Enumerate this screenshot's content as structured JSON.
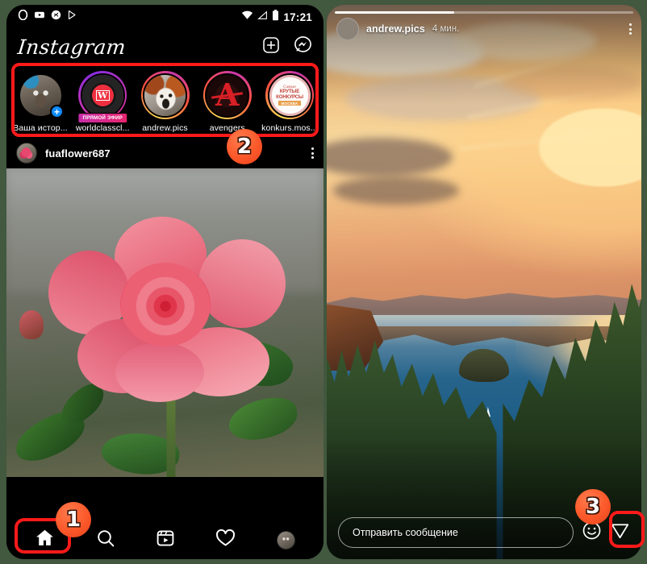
{
  "left_phone": {
    "statusbar": {
      "app_icons": [
        "opera-icon",
        "youtube-icon",
        "shazam-icon",
        "play-store-icon"
      ],
      "wifi_icon": "wifi-icon",
      "signal_icon": "signal-icon",
      "battery_icon": "battery-icon",
      "time": "17:21"
    },
    "header": {
      "logo_text": "Instagram",
      "new_post_label": "+",
      "messenger_icon": "messenger-icon"
    },
    "stories": [
      {
        "name": "Ваша истор...",
        "ring": "none",
        "avatar": "wolf-avatar",
        "has_plus": true,
        "live": null
      },
      {
        "name": "worldclasscl...",
        "ring": "live",
        "avatar": "w-logo-avatar",
        "has_plus": false,
        "live": "ПРЯМОЙ ЭФИР"
      },
      {
        "name": "andrew.pics",
        "ring": "grad",
        "avatar": "red-panda-avatar",
        "has_plus": false,
        "live": null
      },
      {
        "name": "avengers",
        "ring": "grad",
        "avatar": "avengers-avatar",
        "has_plus": false,
        "live": null
      },
      {
        "name": "konkurs.mos...",
        "ring": "orange",
        "avatar": "konkurs-avatar",
        "has_plus": false,
        "live": null
      }
    ],
    "konkurs_avatar_text": {
      "line1": "Самые",
      "line2": "КРУТЫЕ",
      "line3": "КОНКУРСЫ",
      "line4": "МОСКВА"
    },
    "post": {
      "username": "fuaflower687",
      "avatar": "rose-thumbnail-avatar",
      "more_icon": "more-options-icon",
      "image": "pink-rose-photo"
    },
    "bottom_nav": [
      {
        "icon": "home-icon",
        "label": "Главная",
        "active": true
      },
      {
        "icon": "search-icon",
        "label": "Поиск",
        "active": false
      },
      {
        "icon": "reels-icon",
        "label": "Reels",
        "active": false
      },
      {
        "icon": "heart-icon",
        "label": "Нравится",
        "active": false
      },
      {
        "icon": "profile-avatar-icon",
        "label": "Профиль",
        "active": false
      }
    ]
  },
  "right_phone": {
    "story": {
      "progress_percent": 40,
      "username": "andrew.pics",
      "time_ago": "4 мин.",
      "avatar": "andrew-pics-avatar",
      "more_icon": "more-options-icon",
      "photo": "sunset-lake-emerald-bay-photo",
      "message_placeholder": "Отправить сообщение",
      "emoji_icon": "emoji-smiley-icon",
      "send_icon": "send-paperplane-icon"
    }
  },
  "annotations": {
    "accent_color": "#ff1a1a",
    "badge_color": "#fc5a2b",
    "steps": [
      {
        "number": "1",
        "target": "home-nav-button"
      },
      {
        "number": "2",
        "target": "stories-row"
      },
      {
        "number": "3",
        "target": "send-message-button"
      }
    ]
  }
}
